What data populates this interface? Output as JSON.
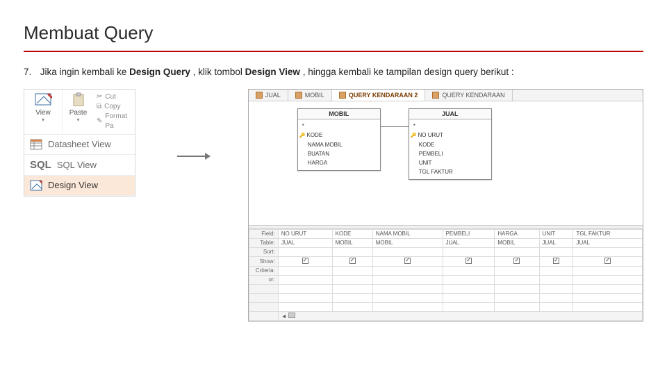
{
  "title": "Membuat Query",
  "step_number": "7.",
  "instruction_pre": " Jika ingin kembali ke ",
  "design_query": "Design Query",
  "instruction_mid": ", klik tombol ",
  "design_view_bold": "Design View",
  "instruction_post": ", hingga kembali ke tampilan design query berikut :",
  "toolbar": {
    "view": "View",
    "paste": "Paste",
    "cut": "Cut",
    "copy": "Copy",
    "format": "Format Pa",
    "datasheet": "Datasheet View",
    "sql": "SQL",
    "sql_view": "SQL View",
    "design_view": "Design View"
  },
  "tabs": [
    "JUAL",
    "MOBIL",
    "QUERY KENDARAAN 2",
    "QUERY KENDARAAN"
  ],
  "active_tab": 2,
  "tables": {
    "mobil": {
      "name": "MOBIL",
      "fields": [
        "*",
        "KODE",
        "NAMA MOBIL",
        "BUATAN",
        "HARGA"
      ],
      "key_index": 1
    },
    "jual": {
      "name": "JUAL",
      "fields": [
        "*",
        "NO URUT",
        "KODE",
        "PEMBELI",
        "UNIT",
        "TGL FAKTUR"
      ],
      "key_index": 1
    }
  },
  "grid_rows": [
    "Field:",
    "Table:",
    "Sort:",
    "Show:",
    "Criteria:",
    "or:"
  ],
  "grid_cols": [
    {
      "field": "NO URUT",
      "table": "JUAL"
    },
    {
      "field": "KODE",
      "table": "MOBIL"
    },
    {
      "field": "NAMA MOBIL",
      "table": "MOBIL"
    },
    {
      "field": "PEMBELI",
      "table": "JUAL"
    },
    {
      "field": "HARGA",
      "table": "MOBIL"
    },
    {
      "field": "UNIT",
      "table": "JUAL"
    },
    {
      "field": "TGL FAKTUR",
      "table": "JUAL"
    }
  ]
}
